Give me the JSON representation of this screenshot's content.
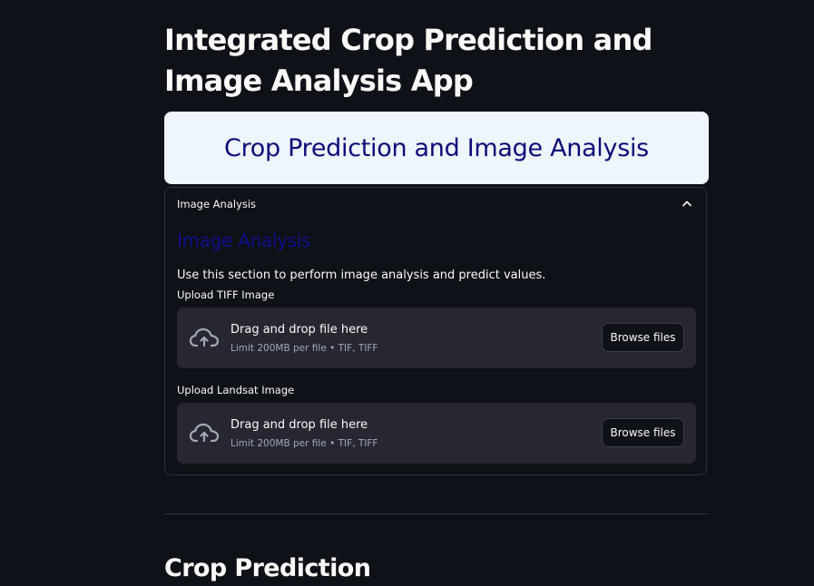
{
  "app": {
    "title": "Integrated Crop Prediction and Image Analysis App"
  },
  "banner": {
    "title": "Crop Prediction and Image Analysis",
    "background": "#eef5fd",
    "text_color": "#0d0b78"
  },
  "expander": {
    "label": "Image Analysis",
    "icon": "chevron-up-icon",
    "expanded": true,
    "heading": "Image Analysis",
    "description": "Use this section to perform image analysis and predict values."
  },
  "uploaders": [
    {
      "label": "Upload TIFF Image",
      "drop_text": "Drag and drop file here",
      "limit_text": "Limit 200MB per file • TIF, TIFF",
      "button_label": "Browse files",
      "icon": "cloud-upload-icon"
    },
    {
      "label": "Upload Landsat Image",
      "drop_text": "Drag and drop file here",
      "limit_text": "Limit 200MB per file • TIF, TIFF",
      "button_label": "Browse files",
      "icon": "cloud-upload-icon"
    }
  ],
  "crop_section": {
    "heading": "Crop Prediction"
  },
  "colors": {
    "background": "#0e1117",
    "dropzone": "#262730",
    "heading_accent": "#10108c"
  }
}
